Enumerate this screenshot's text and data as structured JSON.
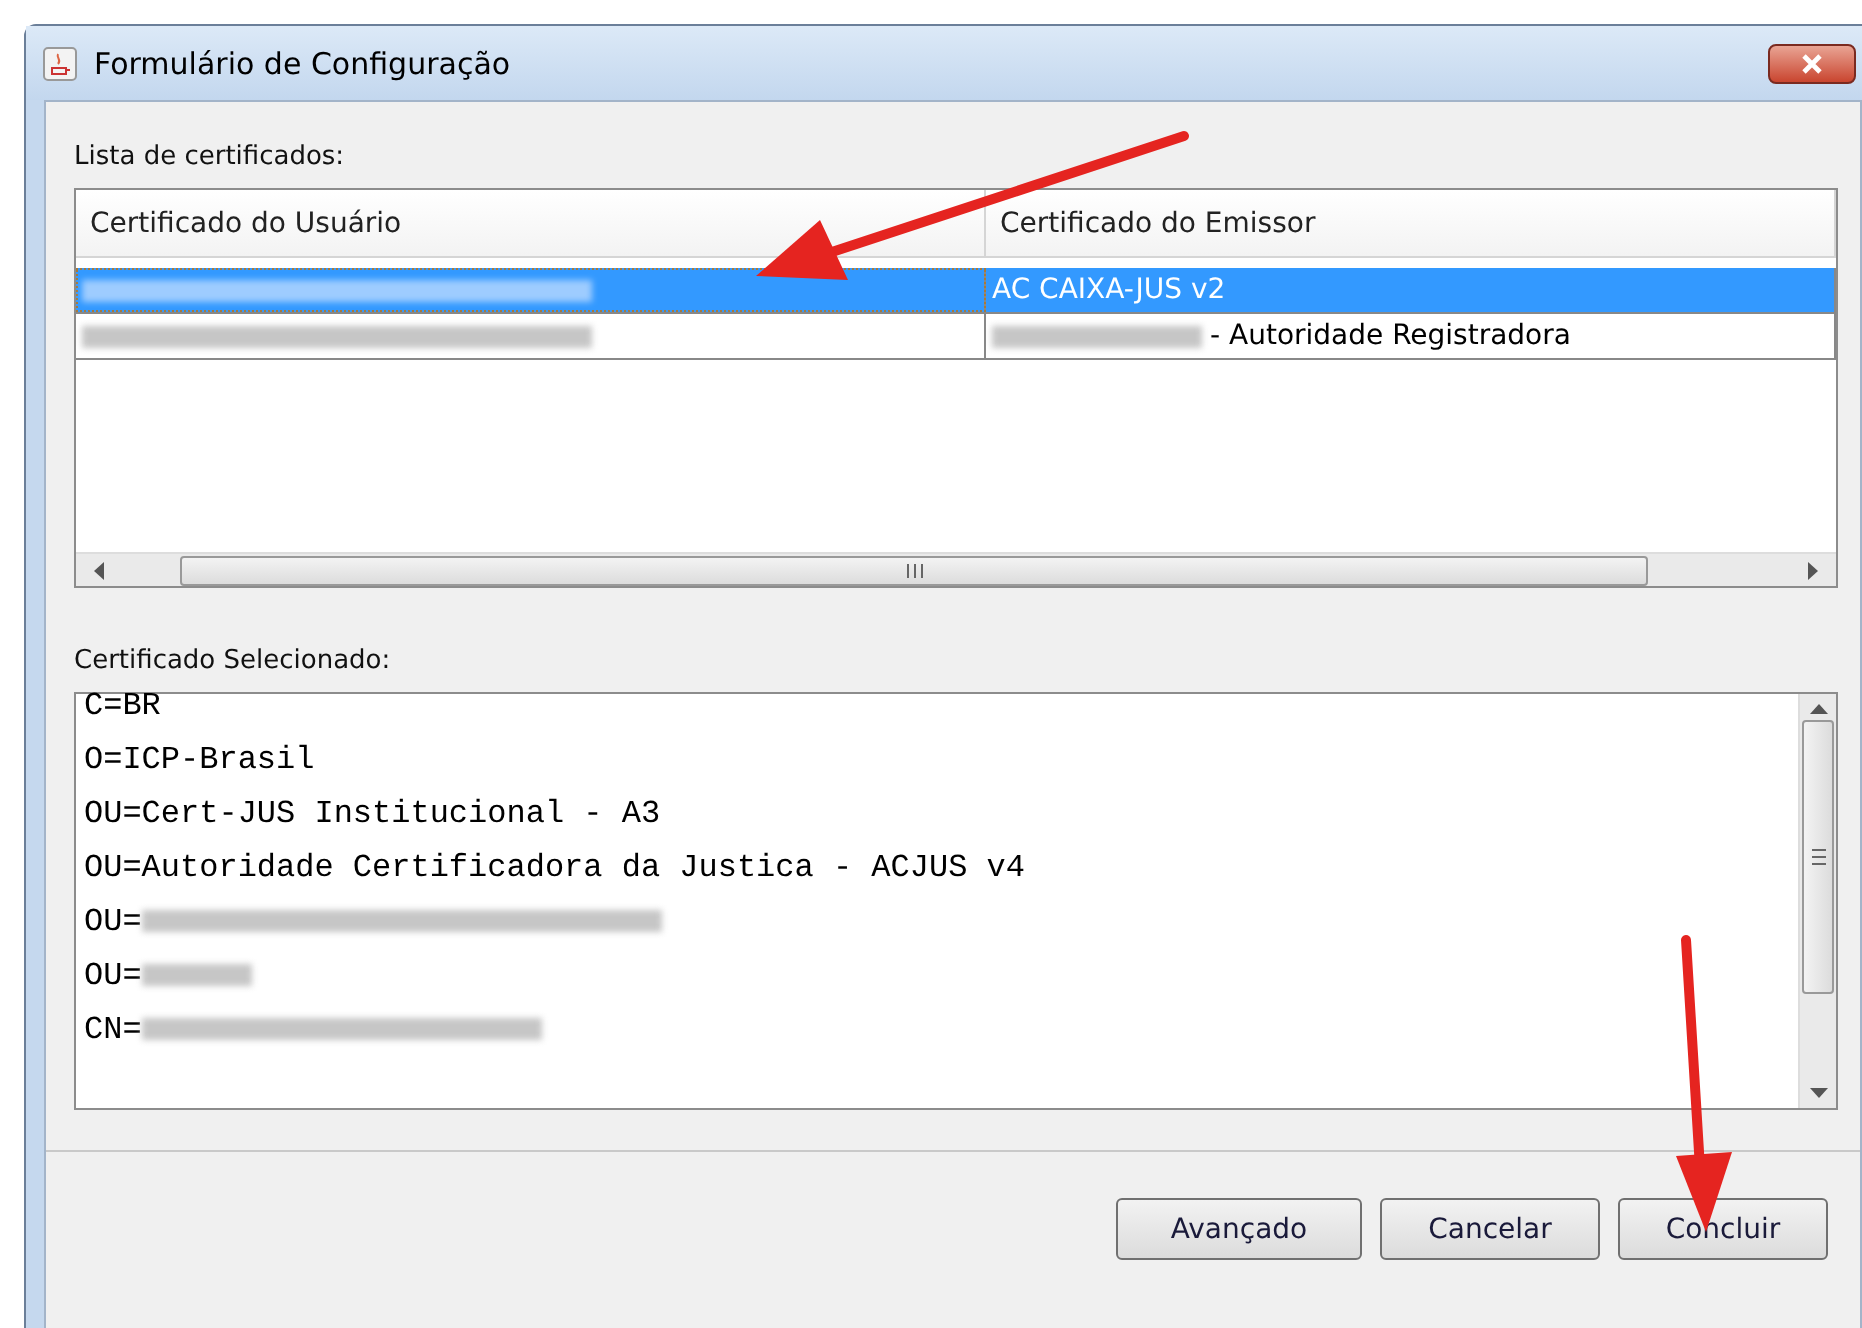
{
  "window": {
    "title": "Formulário de Configuração"
  },
  "list_label": "Lista de certificados:",
  "table": {
    "columns": [
      "Certificado do Usuário",
      "Certificado do Emissor"
    ],
    "rows": [
      {
        "selected": true,
        "user_redacted": true,
        "issuer_redacted": false,
        "issuer": "AC CAIXA-JUS v2"
      },
      {
        "selected": false,
        "user_redacted": true,
        "issuer_redacted": true,
        "issuer": "- Autoridade Registradora"
      }
    ]
  },
  "selected_label": "Certificado Selecionado:",
  "details": [
    {
      "prefix": "C=BR",
      "redacted": false
    },
    {
      "prefix": "O=ICP-Brasil",
      "redacted": false
    },
    {
      "prefix": "OU=Cert-JUS Institucional - A3",
      "redacted": false
    },
    {
      "prefix": "OU=Autoridade Certificadora da Justica - ACJUS v4",
      "redacted": false
    },
    {
      "prefix": "OU=",
      "redacted": true
    },
    {
      "prefix": "OU=",
      "redacted": true
    },
    {
      "prefix": "CN=",
      "redacted": true
    }
  ],
  "buttons": [
    "Avançado",
    "Cancelar",
    "Concluir"
  ]
}
